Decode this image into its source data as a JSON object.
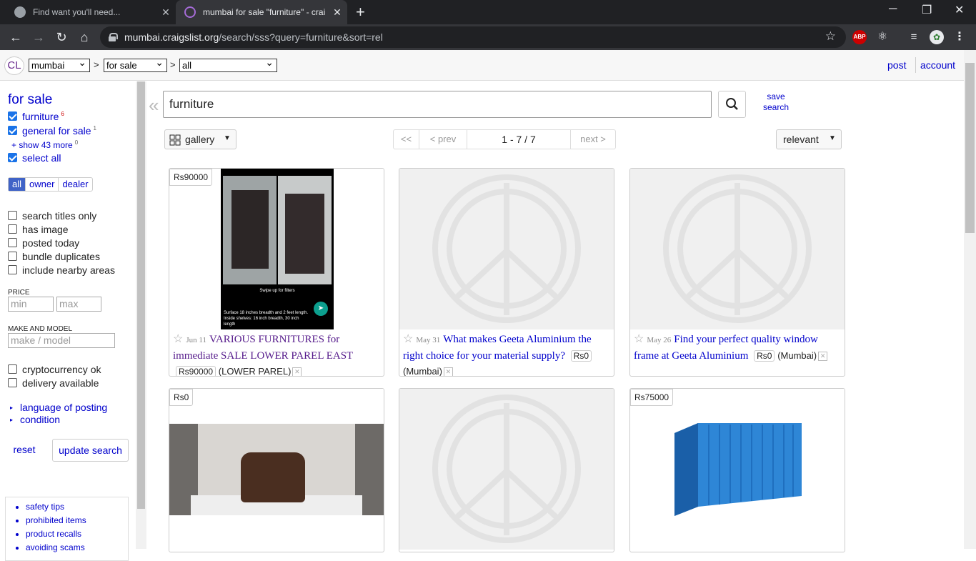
{
  "browser": {
    "tabs": [
      {
        "title": "Find want you'll need..."
      },
      {
        "title": "mumbai for sale \"furniture\" - crai"
      }
    ],
    "url_host": "mumbai.craigslist.org",
    "url_path": "/search/sss?query=furniture&sort=rel",
    "ext_abp": "ABP"
  },
  "header": {
    "logo": "CL",
    "city": "mumbai",
    "section": "for sale",
    "category": "all",
    "separator": ">",
    "post": "post",
    "account": "account"
  },
  "sidebar": {
    "title": "for sale",
    "categories": [
      {
        "label": "furniture",
        "count": "6",
        "checked": true
      },
      {
        "label": "general for sale",
        "count": "1",
        "checked": true
      }
    ],
    "show_more": "show 43 more",
    "show_more_count": "0",
    "select_all": "select all",
    "seller_types": [
      "all",
      "owner",
      "dealer"
    ],
    "filters": [
      "search titles only",
      "has image",
      "posted today",
      "bundle duplicates",
      "include nearby areas"
    ],
    "price_label": "PRICE",
    "min_placeholder": "min",
    "max_placeholder": "max",
    "make_label": "MAKE AND MODEL",
    "make_placeholder": "make / model",
    "extra_filters": [
      "cryptocurrency ok",
      "delivery available"
    ],
    "expanders": [
      "language of posting",
      "condition"
    ],
    "reset": "reset",
    "update": "update search",
    "links": [
      "safety tips",
      "prohibited items",
      "product recalls",
      "avoiding scams"
    ]
  },
  "search": {
    "query": "furniture",
    "save_search": "save search",
    "view": "gallery",
    "pager": {
      "first": "<<",
      "prev": "< prev",
      "range": "1 - 7 / 7",
      "next": "next >"
    },
    "sort": "relevant"
  },
  "listings": [
    {
      "price": "Rs90000",
      "date": "Jun 11",
      "title": "VARIOUS FURNITURES for immediate SALE LOWER PAREL EAST",
      "tag": "Rs90000",
      "location": "(LOWER PAREL)",
      "visited": true,
      "image_caption": "Swipe up for filters",
      "image_text": "Surface 18 inches breadth and 2 feet length. Inside shelves: 16 inch breadth, 30 inch length"
    },
    {
      "price": "",
      "date": "May 31",
      "title": "What makes Geeta Aluminium the right choice for your material supply?",
      "tag": "Rs0",
      "location": "(Mumbai)",
      "visited": false
    },
    {
      "price": "",
      "date": "May 26",
      "title": "Find your perfect quality window frame at Geeta Aluminium",
      "tag": "Rs0",
      "location": "(Mumbai)",
      "visited": false
    },
    {
      "price": "Rs0"
    },
    {
      "price": ""
    },
    {
      "price": "Rs75000"
    }
  ]
}
